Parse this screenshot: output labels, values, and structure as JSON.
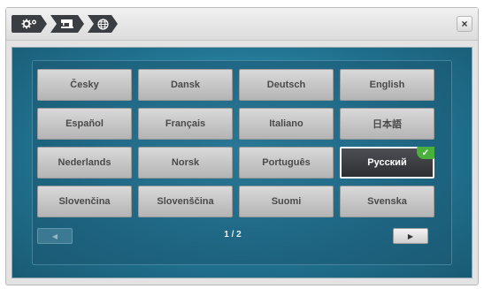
{
  "breadcrumb": {
    "icons": [
      "settings-gears-icon",
      "sewing-machine-icon",
      "globe-icon"
    ]
  },
  "close": {
    "label": "×"
  },
  "languages": [
    "Česky",
    "Dansk",
    "Deutsch",
    "English",
    "Español",
    "Français",
    "Italiano",
    "日本語",
    "Nederlands",
    "Norsk",
    "Português",
    "Русский",
    "Slovenčina",
    "Slovenščina",
    "Suomi",
    "Svenska"
  ],
  "selected_language": "Русский",
  "selected_check": "✓",
  "pager": {
    "page": "1 / 2",
    "prev_label": "◀",
    "next_label": "▶"
  },
  "colors": {
    "screen": "#2a86a6",
    "selected_bg": "#3a3d42",
    "check": "#4ab03c"
  }
}
